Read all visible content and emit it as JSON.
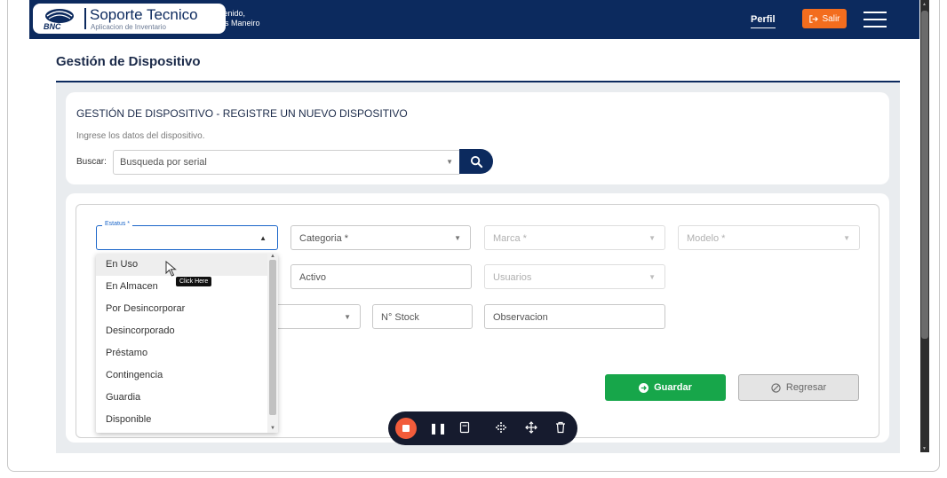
{
  "header": {
    "app_title": "Soporte Tecnico",
    "app_subtitle": "Aplicacion de Inventario",
    "welcome_line1": "Bienvenido,",
    "welcome_line2": "Andrés Maneiro",
    "perfil_label": "Perfil",
    "salir_label": "Salir",
    "logo_text": "BNC"
  },
  "page": {
    "title": "Gestión de Dispositivo"
  },
  "search_card": {
    "title": "GESTIÓN DE DISPOSITIVO - REGISTRE UN NUEVO DISPOSITIVO",
    "subtitle": "Ingrese los datos del dispositivo.",
    "buscar_label": "Buscar:",
    "buscar_placeholder": "Busqueda por serial"
  },
  "form": {
    "estatus_label": "Estatus *",
    "estatus_value": "",
    "categoria_placeholder": "Categoria *",
    "marca_placeholder": "Marca *",
    "modelo_placeholder": "Modelo *",
    "activo_placeholder": "Activo",
    "usuarios_placeholder": "Usuarios",
    "stock_placeholder": "N° Stock",
    "observacion_placeholder": "Observacion",
    "guardar_label": "Guardar",
    "regresar_label": "Regresar"
  },
  "estatus_options": [
    "En Uso",
    "En Almacen",
    "Por Desincorporar",
    "Desincorporado",
    "Préstamo",
    "Contingencia",
    "Guardia",
    "Disponible"
  ],
  "tooltip": "Click Here",
  "colors": {
    "navbar": "#0c2a5e",
    "salir": "#f36d1e",
    "guardar": "#17a64a",
    "focus": "#1b66c9",
    "recorder_stop": "#f25c3b"
  }
}
